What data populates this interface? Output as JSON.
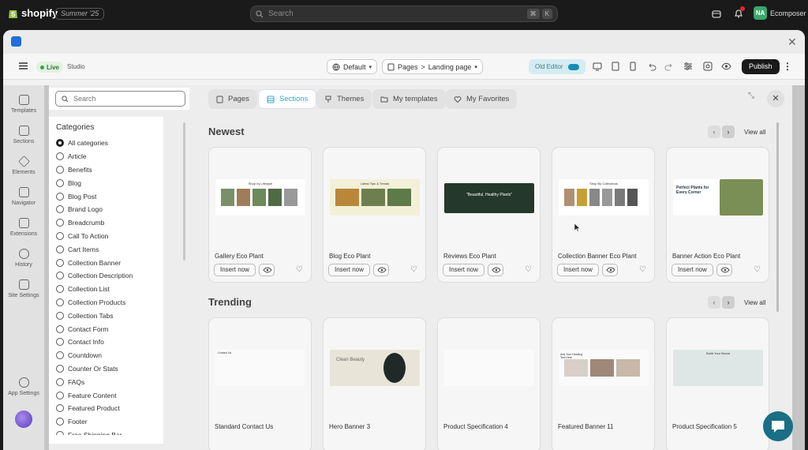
{
  "shopify": {
    "brand": "shopify",
    "edition": "Summer '25",
    "search_placeholder": "Search",
    "kbd": [
      "⌘",
      "K"
    ],
    "user_initials": "NA",
    "user_name": "Ecomposer"
  },
  "toolbar": {
    "live": "Live",
    "studio": "Studio",
    "theme": "Default",
    "pages": "Pages",
    "page_sep": ">",
    "landing": "Landing page",
    "old_editor": "Old Editor",
    "publish": "Publish"
  },
  "rail": {
    "items": [
      {
        "label": "Templates"
      },
      {
        "label": "Sections"
      },
      {
        "label": "Elements"
      },
      {
        "label": "Navigator"
      },
      {
        "label": "Extensions"
      },
      {
        "label": "History"
      },
      {
        "label": "Site Settings"
      }
    ],
    "app_settings": "App Settings"
  },
  "search": {
    "placeholder": "Search"
  },
  "categories": {
    "title": "Categories",
    "selected": "All categories",
    "items": [
      "All categories",
      "Article",
      "Benefits",
      "Blog",
      "Blog Post",
      "Brand Logo",
      "Breadcrumb",
      "Call To Action",
      "Cart Items",
      "Collection Banner",
      "Collection Description",
      "Collection List",
      "Collection Products",
      "Collection Tabs",
      "Contact Form",
      "Contact Info",
      "Countdown",
      "Counter Or Stats",
      "FAQs",
      "Feature Content",
      "Featured Product",
      "Footer",
      "Free Shipping Bar"
    ]
  },
  "tabs": [
    {
      "label": "Pages",
      "icon": "page-icon"
    },
    {
      "label": "Sections",
      "icon": "sections-icon",
      "active": true
    },
    {
      "label": "Themes",
      "icon": "theme-icon"
    },
    {
      "label": "My templates",
      "icon": "folder-icon"
    },
    {
      "label": "My Favorites",
      "icon": "heart-icon"
    }
  ],
  "newest": {
    "title": "Newest",
    "view_all": "View all",
    "cards": [
      {
        "name": "Gallery Eco Plant",
        "insert": "Insert now",
        "thumb_text": "Shop by Lifestyle"
      },
      {
        "name": "Blog Eco Plant",
        "insert": "Insert now",
        "thumb_text": "Latest Tips & Trends"
      },
      {
        "name": "Reviews Eco Plant",
        "insert": "Insert now",
        "thumb_text": "\"Beautiful, Healthy Plants\""
      },
      {
        "name": "Collection Banner Eco Plant",
        "insert": "Insert now",
        "thumb_text": "Shop By Collections"
      },
      {
        "name": "Banner Action Eco Plant",
        "insert": "Insert now",
        "thumb_text": "Perfect Plants for Every Corner"
      }
    ]
  },
  "trending": {
    "title": "Trending",
    "view_all": "View all",
    "cards": [
      {
        "name": "Standard Contact Us",
        "thumb_text": "Contact Us"
      },
      {
        "name": "Hero Banner 3",
        "thumb_text": "Clean Beauty"
      },
      {
        "name": "Product Specification 4",
        "thumb_text": ""
      },
      {
        "name": "Featured Banner 11",
        "thumb_text": "Add Your Heading Text Here"
      },
      {
        "name": "Product Specification 5",
        "thumb_text": "Build Your Brand"
      }
    ]
  },
  "colors": {
    "accent": "#30a7cf",
    "publish_bg": "#1a1a1a",
    "live_green": "#2da44e",
    "chat": "#1a6e85",
    "plant_dark": "#24382c"
  }
}
